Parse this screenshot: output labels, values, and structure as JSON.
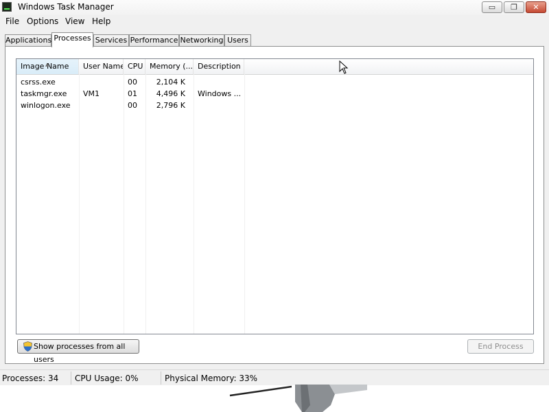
{
  "window": {
    "title": "Windows Task Manager",
    "controls": {
      "minimize": "▭",
      "maximize": "❐",
      "close": "✕"
    }
  },
  "menu": [
    "File",
    "Options",
    "View",
    "Help"
  ],
  "tabs": [
    {
      "label": "Applications",
      "active": false
    },
    {
      "label": "Processes",
      "active": true
    },
    {
      "label": "Services",
      "active": false
    },
    {
      "label": "Performance",
      "active": false
    },
    {
      "label": "Networking",
      "active": false
    },
    {
      "label": "Users",
      "active": false
    }
  ],
  "table": {
    "columns": [
      "Image Name",
      "User Name",
      "CPU",
      "Memory (...",
      "Description"
    ],
    "sort_column": "Image Name",
    "rows": [
      {
        "image": "csrss.exe",
        "user": "",
        "cpu": "00",
        "memory": "2,104 K",
        "description": ""
      },
      {
        "image": "taskmgr.exe",
        "user": "VM1",
        "cpu": "01",
        "memory": "4,496 K",
        "description": "Windows ..."
      },
      {
        "image": "winlogon.exe",
        "user": "",
        "cpu": "00",
        "memory": "2,796 K",
        "description": ""
      }
    ]
  },
  "buttons": {
    "show_all": "Show processes from all users",
    "end_process": "End Process"
  },
  "status": {
    "processes": "Processes: 34",
    "cpu": "CPU Usage: 0%",
    "memory": "Physical Memory: 33%"
  },
  "colors": {
    "window_bg": "#f0f0f0",
    "sorted_header": "#e6f3fb",
    "close_button": "#c64a33"
  }
}
